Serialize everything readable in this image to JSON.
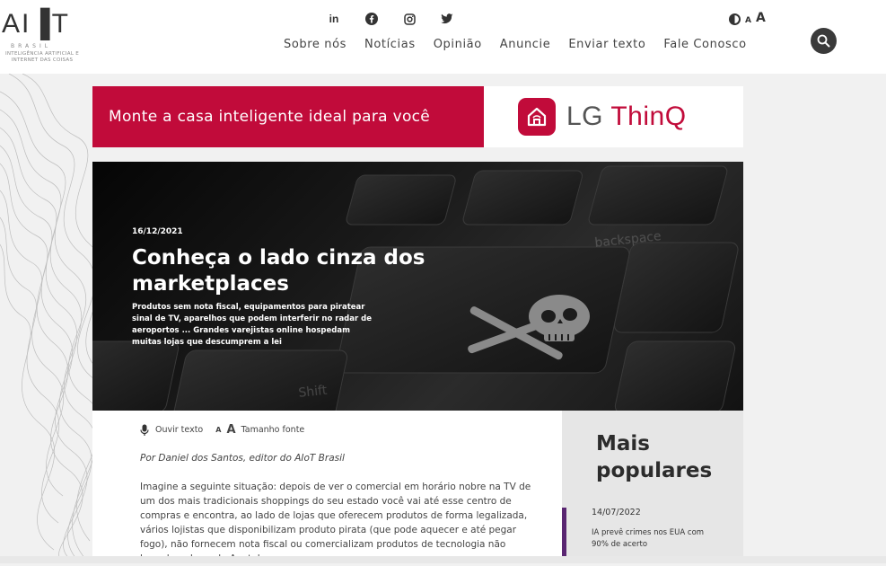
{
  "logo": {
    "mark": "AI▐T",
    "sub": "BRASIL",
    "tagline": "INTELIGÊNCIA ARTIFICIAL E INTERNET DAS COISAS"
  },
  "social": [
    {
      "name": "linkedin-icon",
      "glyph": "in"
    },
    {
      "name": "facebook-icon",
      "glyph": "f"
    },
    {
      "name": "instagram-icon",
      "glyph": "◎"
    },
    {
      "name": "twitter-icon",
      "glyph": "🐦"
    }
  ],
  "nav": {
    "items": [
      "Sobre nós",
      "Notícias",
      "Opinião",
      "Anuncie",
      "Enviar texto",
      "Fale Conosco"
    ]
  },
  "accessibility": {
    "small_a": "A",
    "large_a": "A"
  },
  "ad": {
    "headline": "Monte a casa inteligente ideal para você",
    "brand_lg": "LG",
    "brand_thinq": "ThinQ",
    "colors": {
      "brand": "#c10b3a"
    }
  },
  "hero": {
    "date": "16/12/2021",
    "title": "Conheça o lado cinza dos marketplaces",
    "lead": "Produtos sem nota fiscal, equipamentos para piratear sinal de TV, aparelhos que podem interferir no radar de aeroportos ... Grandes varejistas online hospedam muitas lojas que descumprem a lei"
  },
  "article": {
    "listen_label": "Ouvir texto",
    "font_small": "A",
    "font_large": "A",
    "font_label": "Tamanho fonte",
    "byline": "Por Daniel dos Santos, editor do AIoT Brasil",
    "body": "Imagine a seguinte situação: depois de ver o comercial em horário nobre na TV de um dos mais tradicionais shoppings do seu estado você vai até esse centro de compras e encontra, ao lado de lojas que oferecem produtos de forma legalizada, vários lojistas que disponibilizam produto pirata (que pode aquecer e até pegar fogo), não fornecem nota fiscal ou comercializam produtos de tecnologia não homologados pela Anatel."
  },
  "popular": {
    "heading": "Mais populares",
    "items": [
      {
        "date": "14/07/2022",
        "title": "IA prevê crimes nos EUA com 90% de acerto"
      }
    ],
    "colors": {
      "accent": "#5a2672"
    }
  }
}
